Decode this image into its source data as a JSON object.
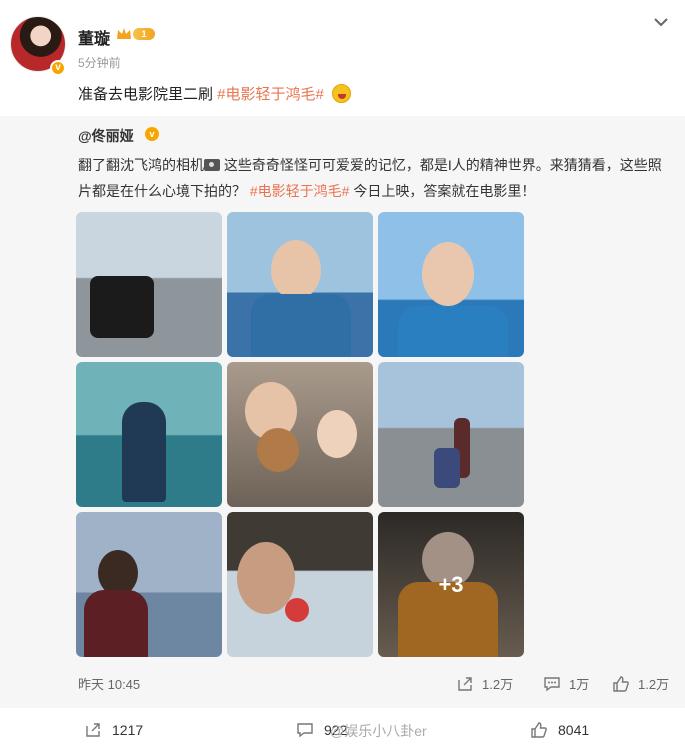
{
  "post": {
    "username": "董璇",
    "level": "1",
    "time": "5分钟前",
    "text": "准备去电影院里二刷 ",
    "hashtag": "#电影轻于鸿毛#"
  },
  "repost": {
    "username": "@佟丽娅",
    "text_part1": "翻了翻沈飞鸿的相机",
    "text_part2": " 这些奇奇怪怪可可爱爱的记忆，都是I人的精神世界。来猜猜看，这些照片都是在什么心境下拍的？ ",
    "hashtag": "#电影轻于鸿毛#",
    "text_part3": " 今日上映，答案就在电影里！",
    "more_photos": "+3",
    "time": "昨天 10:45",
    "shares": "1.2万",
    "comments": "1万",
    "likes": "1.2万"
  },
  "footer": {
    "shares": "1217",
    "comments": "922",
    "likes": "8041",
    "watermark": "@娱乐小八卦er"
  },
  "colors": {
    "accent": "#eb7350",
    "verified": "#f7a600"
  }
}
